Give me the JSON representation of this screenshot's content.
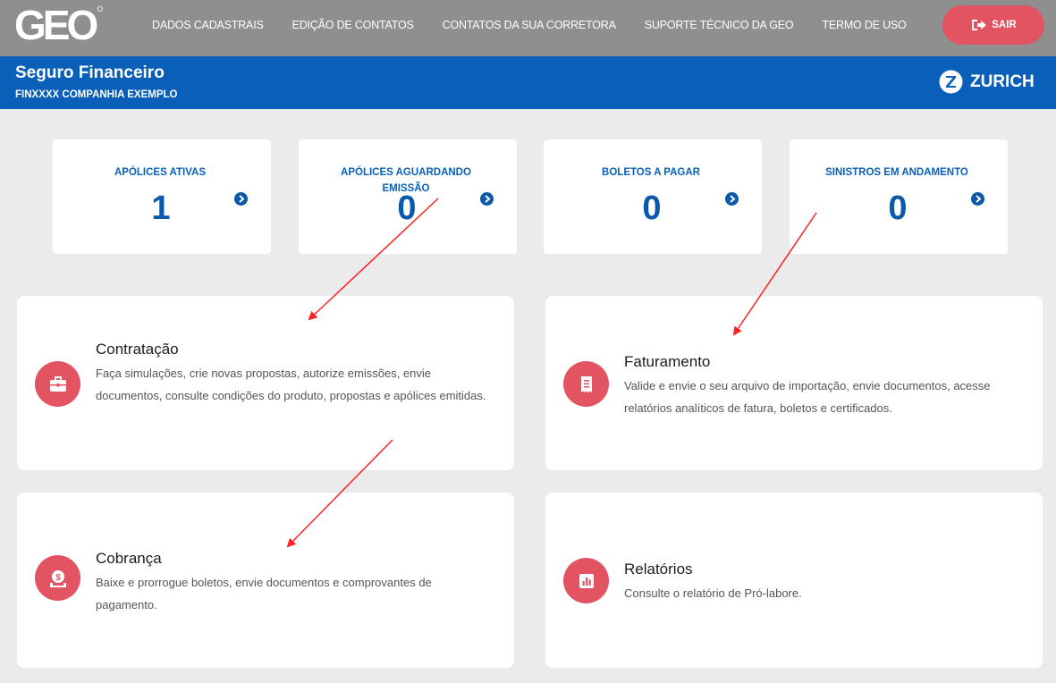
{
  "header": {
    "logo_text": "GEO",
    "nav": [
      "DADOS CADASTRAIS",
      "EDIÇÃO DE CONTATOS",
      "CONTATOS DA SUA CORRETORA",
      "SUPORTE TÉCNICO DA GEO",
      "TERMO DE USO"
    ],
    "logout_label": "SAIR"
  },
  "banner": {
    "title": "Seguro Financeiro",
    "subtitle_code": "FINXXXX",
    "subtitle_company": "COMPANHIA EXEMPLO",
    "brand": "ZURICH"
  },
  "stats": [
    {
      "label": "APÓLICES ATIVAS",
      "value": "1"
    },
    {
      "label": "APÓLICES AGUARDANDO EMISSÃO",
      "value": "0"
    },
    {
      "label": "BOLETOS A PAGAR",
      "value": "0"
    },
    {
      "label": "SINISTROS EM ANDAMENTO",
      "value": "0"
    }
  ],
  "cards": [
    {
      "title": "Contratação",
      "description": "Faça simulações, crie novas propostas, autorize emissões, envie documentos, consulte condições do produto, propostas e apólices emitidas.",
      "icon": "briefcase-icon"
    },
    {
      "title": "Faturamento",
      "description": "Valide e envie o seu arquivo de importação, envie documentos, acesse relatórios analíticos de fatura, boletos e certificados.",
      "icon": "receipt-icon"
    },
    {
      "title": "Cobrança",
      "description": "Baixe e prorrogue boletos, envie documentos e comprovantes de pagamento.",
      "icon": "money-icon"
    },
    {
      "title": "Relatórios",
      "description": "Consulte o relatório de Pró-labore.",
      "icon": "bar-chart-icon"
    }
  ],
  "colors": {
    "topbar": "#8f8f8f",
    "banner": "#0a60b8",
    "accent": "#e25462",
    "stat_text": "#0a5aa9",
    "background": "#ecebeb",
    "annotation_arrow": "#ff2222"
  }
}
